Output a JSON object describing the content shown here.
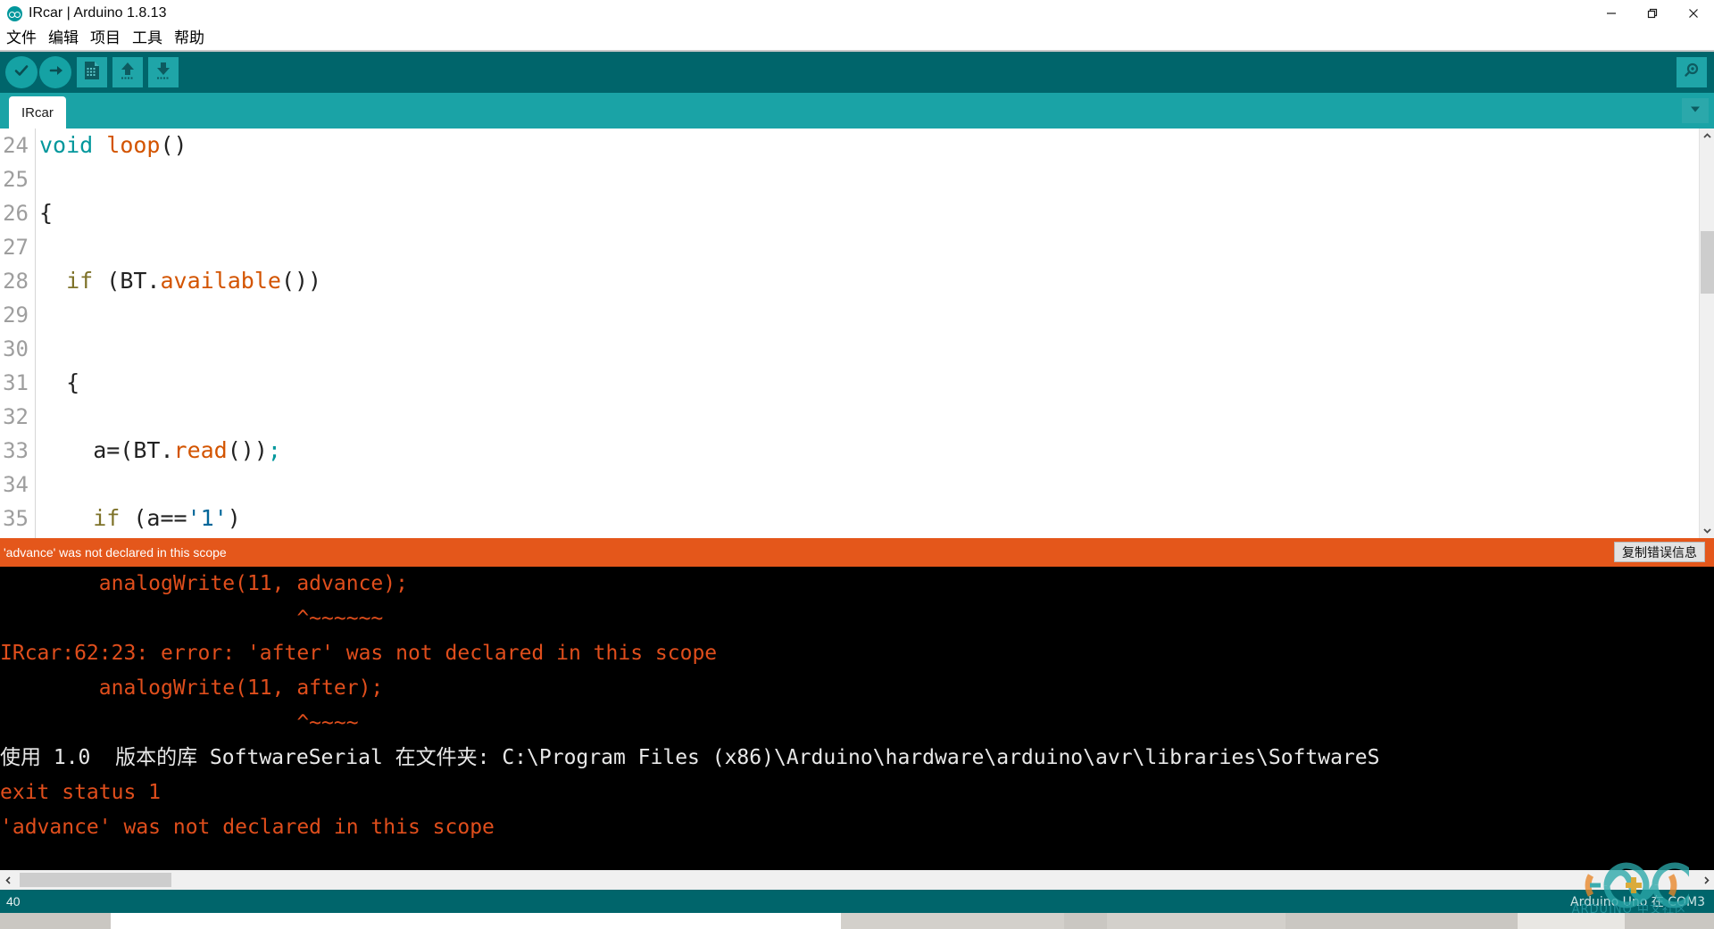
{
  "window": {
    "title": "IRcar | Arduino 1.8.13",
    "logo_icon": "arduino-logo-icon",
    "controls": {
      "minimize": "minimize-icon",
      "maximize": "restore-icon",
      "close": "close-icon"
    }
  },
  "menubar": {
    "items": [
      {
        "label": "文件",
        "name": "menu-file"
      },
      {
        "label": "编辑",
        "name": "menu-edit"
      },
      {
        "label": "项目",
        "name": "menu-sketch"
      },
      {
        "label": "工具",
        "name": "menu-tools"
      },
      {
        "label": "帮助",
        "name": "menu-help"
      }
    ]
  },
  "toolbar": {
    "verify": "verify-icon",
    "upload": "upload-icon",
    "new": "new-sketch-icon",
    "open": "open-sketch-icon",
    "save": "save-sketch-icon",
    "serial_monitor": "serial-monitor-icon"
  },
  "tabs": {
    "active": "IRcar",
    "dropdown_icon": "chevron-down-icon"
  },
  "editor": {
    "lines": [
      {
        "no": "24",
        "tokens": [
          {
            "t": "void",
            "c": "k-type"
          },
          {
            "t": " ",
            "c": ""
          },
          {
            "t": "loop",
            "c": "k-func"
          },
          {
            "t": "()",
            "c": "k-punct"
          }
        ]
      },
      {
        "no": "25",
        "tokens": []
      },
      {
        "no": "26",
        "tokens": [
          {
            "t": "{",
            "c": "k-punct"
          }
        ]
      },
      {
        "no": "27",
        "tokens": []
      },
      {
        "no": "28",
        "tokens": [
          {
            "t": "  ",
            "c": ""
          },
          {
            "t": "if",
            "c": "k-kw"
          },
          {
            "t": " (BT.",
            "c": "k-punct"
          },
          {
            "t": "available",
            "c": "k-method"
          },
          {
            "t": "())",
            "c": "k-punct"
          }
        ]
      },
      {
        "no": "29",
        "tokens": []
      },
      {
        "no": "30",
        "tokens": []
      },
      {
        "no": "31",
        "tokens": [
          {
            "t": "  {",
            "c": "k-punct"
          }
        ]
      },
      {
        "no": "32",
        "tokens": []
      },
      {
        "no": "33",
        "tokens": [
          {
            "t": "    a=(BT.",
            "c": "k-punct"
          },
          {
            "t": "read",
            "c": "k-method"
          },
          {
            "t": "())",
            "c": "k-punct"
          },
          {
            "t": ";",
            "c": "k-semi"
          }
        ]
      },
      {
        "no": "34",
        "tokens": []
      },
      {
        "no": "35",
        "tokens": [
          {
            "t": "    ",
            "c": ""
          },
          {
            "t": "if",
            "c": "k-kw"
          },
          {
            "t": " (a==",
            "c": "k-punct"
          },
          {
            "t": "'1'",
            "c": "k-str"
          },
          {
            "t": ")",
            "c": "k-punct"
          }
        ]
      }
    ],
    "scrollbar": {
      "up_icon": "scroll-up-icon",
      "down_icon": "scroll-down-icon"
    }
  },
  "error_bar": {
    "message": "'advance' was not declared in this scope",
    "copy_button": "复制错误信息",
    "background": "#e4571b"
  },
  "console": {
    "lines": [
      {
        "text": "        analogWrite(11, advance);",
        "color": "orange"
      },
      {
        "text": "                        ^~~~~~~",
        "color": "orange"
      },
      {
        "text": "IRcar:62:23: error: 'after' was not declared in this scope",
        "color": "orange"
      },
      {
        "text": "        analogWrite(11, after);",
        "color": "orange"
      },
      {
        "text": "                        ^~~~~",
        "color": "orange"
      },
      {
        "text": "使用 1.0  版本的库 SoftwareSerial 在文件夹: C:\\Program Files (x86)\\Arduino\\hardware\\arduino\\avr\\libraries\\SoftwareS",
        "color": "white"
      },
      {
        "text": "exit status 1",
        "color": "orange"
      },
      {
        "text": "'advance' was not declared in this scope",
        "color": "orange"
      }
    ],
    "hscroll": {
      "left_icon": "scroll-left-icon",
      "right_icon": "scroll-right-icon"
    }
  },
  "statusbar": {
    "line_number": "40",
    "board": "Arduino Uno 在 COM3"
  },
  "watermark": {
    "text": "ARDUINO 中文社区",
    "icon": "arduino-infinity-logo-icon"
  },
  "colors": {
    "teal_dark": "#00656b",
    "teal": "#1aa3a6",
    "error_orange": "#e4571b",
    "console_bg": "#000000",
    "console_text": "#e04e1c"
  }
}
